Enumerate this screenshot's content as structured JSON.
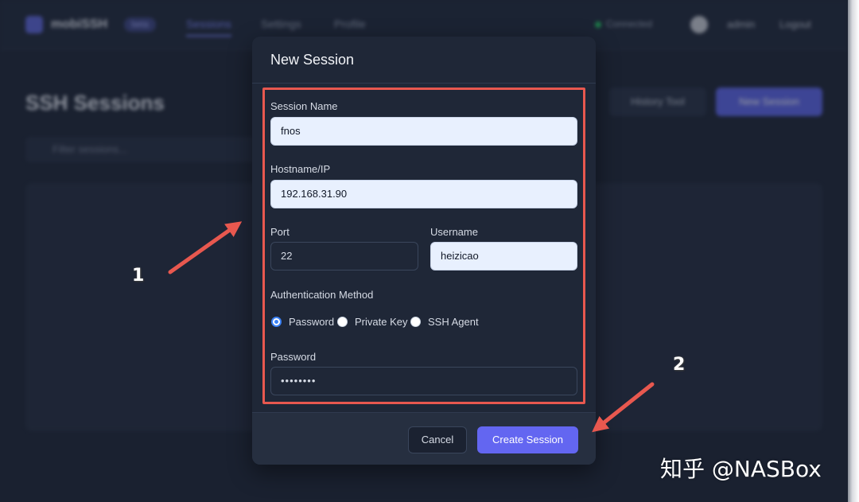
{
  "background_app": {
    "brand": "mobiSSH",
    "brand_badge": "beta",
    "nav": [
      "Sessions",
      "Settings",
      "Profile"
    ],
    "connection_status": "Connected",
    "user": "admin",
    "logout": "Logout",
    "page_title": "SSH Sessions",
    "history_button": "History Tool",
    "new_button": "New Session",
    "search_placeholder": "Filter sessions..."
  },
  "modal": {
    "title": "New Session",
    "fields": {
      "session_name": {
        "label": "Session Name",
        "value": "fnos"
      },
      "hostname": {
        "label": "Hostname/IP",
        "value": "192.168.31.90"
      },
      "port": {
        "label": "Port",
        "value": "22"
      },
      "username": {
        "label": "Username",
        "value": "heizicao"
      },
      "auth_method": {
        "label": "Authentication Method",
        "options": [
          "Password",
          "Private Key",
          "SSH Agent"
        ],
        "selected": "Password"
      },
      "password": {
        "label": "Password",
        "value": "••••••••"
      }
    },
    "cancel_label": "Cancel",
    "create_label": "Create Session"
  },
  "annotations": {
    "marker_1": "1",
    "marker_2": "2",
    "highlight_color": "#e8584f"
  },
  "watermark": "知乎 @NASBox",
  "colors": {
    "accent": "#6366f1",
    "radio_checked": "#3b82f6",
    "input_bg": "#e8f0fe"
  }
}
